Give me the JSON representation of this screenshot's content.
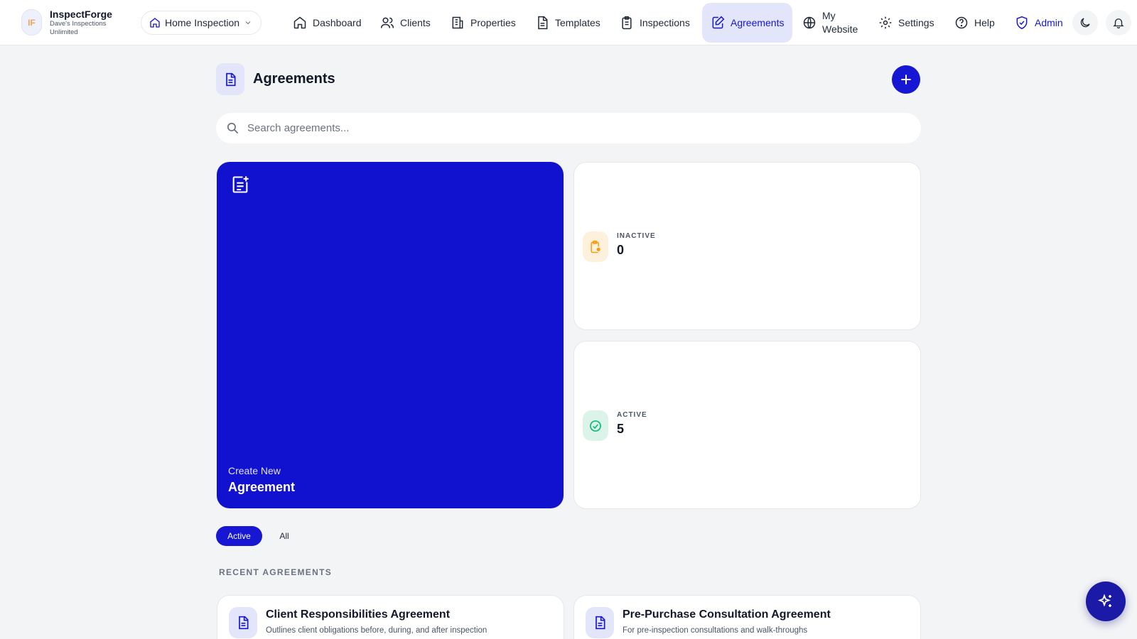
{
  "app": {
    "name": "InspectForge",
    "org": "Dave's Inspections Unlimited",
    "logo_mark": "IF"
  },
  "workspace": {
    "label": "Home Inspection",
    "icon": "home-icon"
  },
  "nav": {
    "dashboard": "Dashboard",
    "clients": "Clients",
    "properties": "Properties",
    "templates": "Templates",
    "inspections": "Inspections",
    "agreements": "Agreements",
    "my_website": "My Website",
    "settings": "Settings",
    "help": "Help",
    "admin": "Admin",
    "active": "Agreements"
  },
  "page": {
    "title": "Agreements",
    "search_placeholder": "Search agreements...",
    "search_value": ""
  },
  "create_card": {
    "small": "Create New",
    "big": "Agreement"
  },
  "stats": {
    "inactive": {
      "label": "INACTIVE",
      "value": "0",
      "color": "#f59e0b"
    },
    "active": {
      "label": "ACTIVE",
      "value": "5",
      "color": "#10b981"
    }
  },
  "filters": {
    "active": "Active",
    "all": "All",
    "selected": "Active"
  },
  "recent": {
    "label": "RECENT AGREEMENTS",
    "items": [
      {
        "title": "Client Responsibilities Agreement",
        "description": "Outlines client obligations before, during, and after inspection"
      },
      {
        "title": "Pre-Purchase Consultation Agreement",
        "description": "For pre-inspection consultations and walk-throughs"
      }
    ]
  },
  "colors": {
    "accent": "#1616d3",
    "accent_light": "#e3e5fb",
    "page_bg": "#f3f4f6"
  }
}
